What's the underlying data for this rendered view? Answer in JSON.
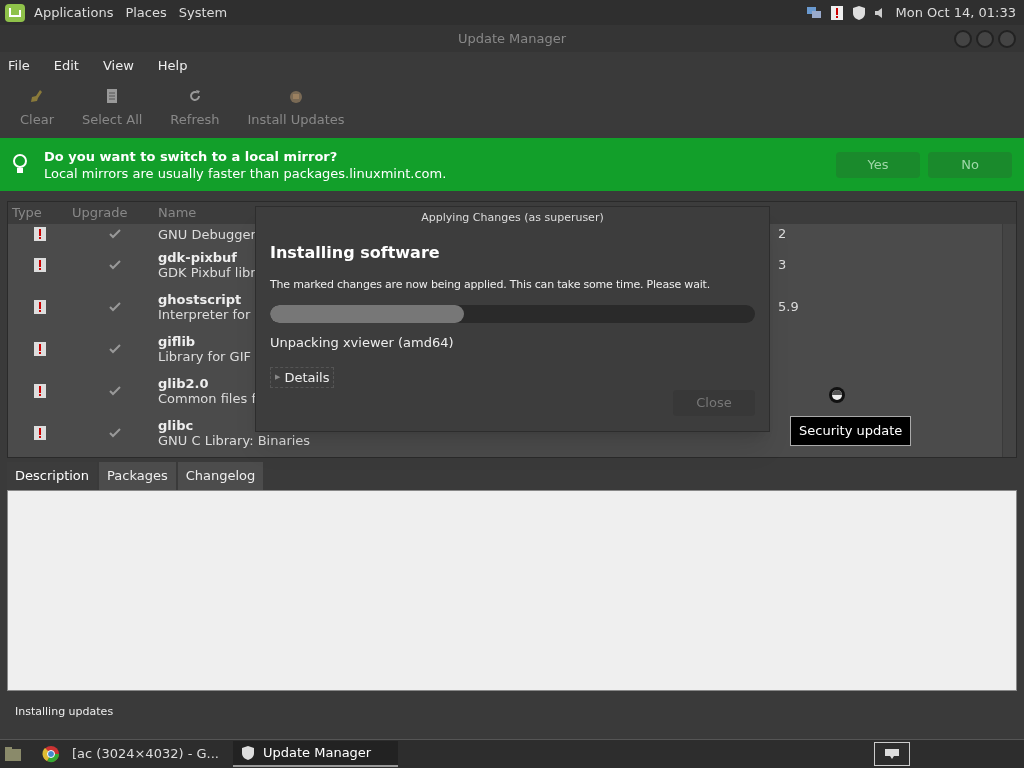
{
  "top_panel": {
    "menus": [
      "Applications",
      "Places",
      "System"
    ],
    "clock": "Mon Oct 14, 01:33"
  },
  "window": {
    "title": "Update Manager"
  },
  "menubar": [
    "File",
    "Edit",
    "View",
    "Help"
  ],
  "toolbar": [
    {
      "label": "Clear",
      "kind": "broom"
    },
    {
      "label": "Select All",
      "kind": "page"
    },
    {
      "label": "Refresh",
      "kind": "refresh"
    },
    {
      "label": "Install Updates",
      "kind": "package"
    }
  ],
  "banner": {
    "title": "Do you want to switch to a local mirror?",
    "text": "Local mirrors are usually faster than packages.linuxmint.com.",
    "buttons": [
      "Yes",
      "No"
    ]
  },
  "table": {
    "columns": [
      "Type",
      "Upgrade",
      "Name"
    ],
    "rows": [
      {
        "description": "GNU Debugger",
        "column_4": "2",
        "checked": true
      },
      {
        "name": "gdk-pixbuf",
        "description": "GDK Pixbuf libr",
        "column_4": "3",
        "checked": true
      },
      {
        "name": "ghostscript",
        "description": "Interpreter for",
        "column_4": "5.9",
        "checked": true
      },
      {
        "name": "giflib",
        "description": "Library for GIF",
        "checked": true
      },
      {
        "name": "glib2.0",
        "description": "Common files f",
        "checked": true
      },
      {
        "name": "glibc",
        "description": "GNU C Library: Binaries",
        "checked": true
      }
    ]
  },
  "dialog": {
    "title": "Applying Changes (as superuser)",
    "heading": "Installing software",
    "message": "The marked changes are now being applied. This can take some time. Please wait.",
    "progress": {
      "level": 0.4
    },
    "status": "Unpacking xviewer (amd64)",
    "details": {
      "label": "Details",
      "marker": "▶",
      "expanded": false
    },
    "close_button": "Close"
  },
  "tooltip": "Security update",
  "tabs": [
    {
      "label": "Description",
      "selected": true
    },
    {
      "label": "Packages",
      "selected": false
    },
    {
      "label": "Changelog",
      "selected": false
    }
  ],
  "status_bar": "Installing updates",
  "taskbar": [
    {
      "label": "[ac (3024×4032) - G...",
      "selected": false
    },
    {
      "label": "Update Manager",
      "selected": true
    }
  ]
}
